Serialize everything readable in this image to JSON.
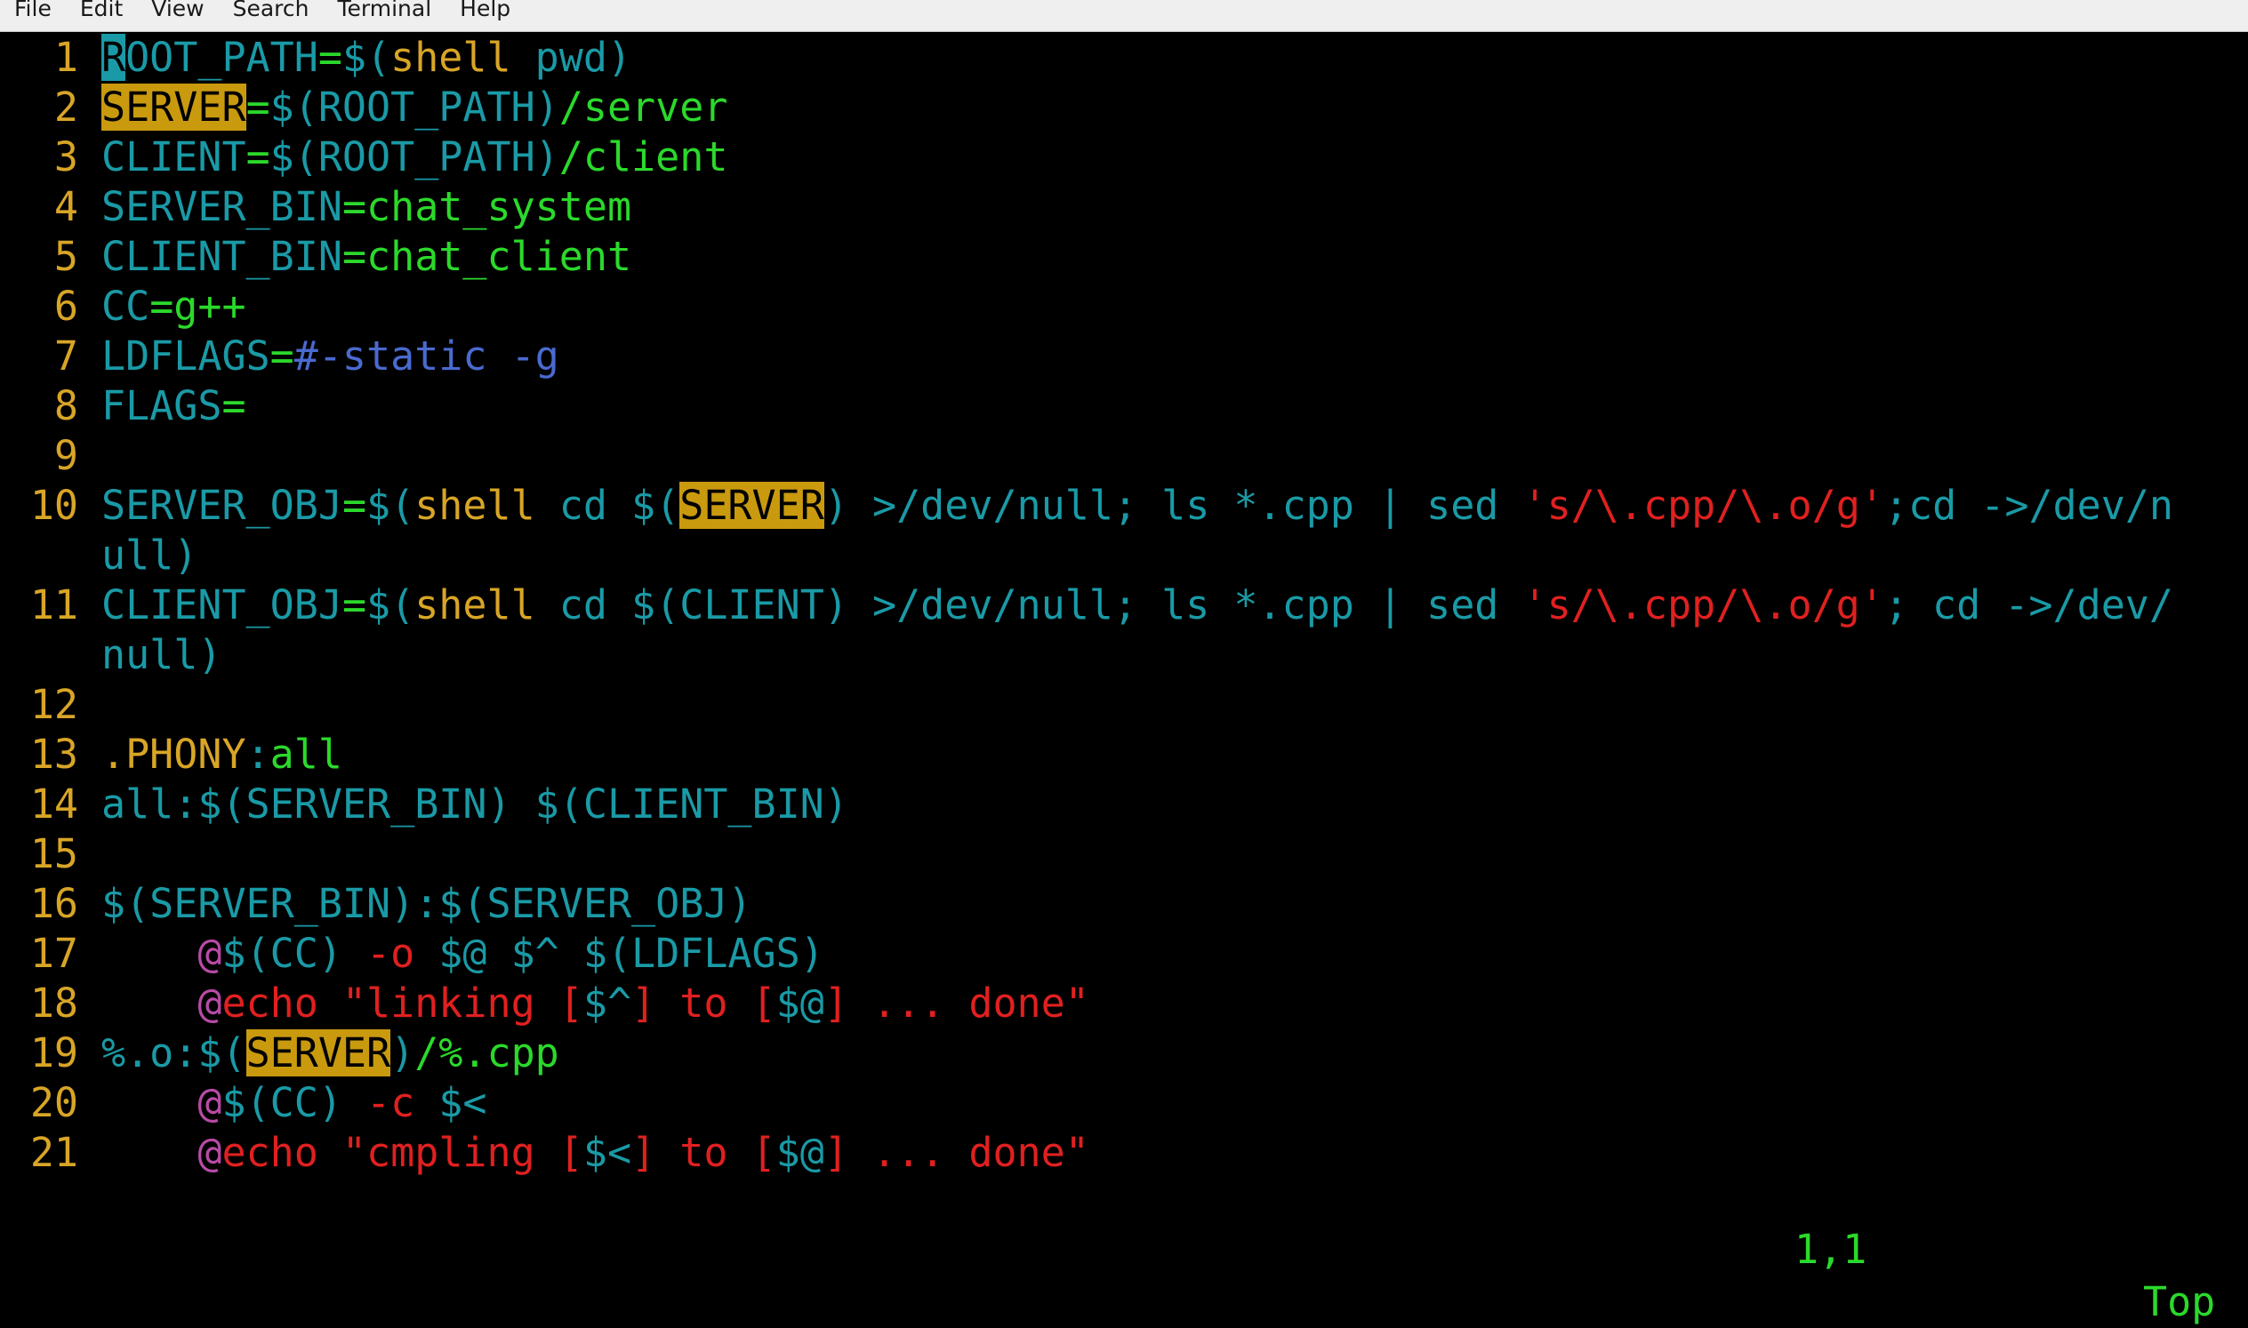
{
  "menubar": {
    "items": [
      "File",
      "Edit",
      "View",
      "Search",
      "Terminal",
      "Help"
    ]
  },
  "colors": {
    "background": "#000000",
    "line_number": "#d8a526",
    "identifier": "#1a9aa6",
    "value": "#2bd92b",
    "function": "#d8a526",
    "string": "#e02020",
    "comment": "#4a6ad0",
    "recipe_prefix": "#b84aa6",
    "search_highlight": "#c99a0e",
    "cursor": "#1a9aa6"
  },
  "editor": {
    "lines": [
      {
        "n": "1",
        "segs": [
          {
            "t": "R",
            "c": "cursor"
          },
          {
            "t": "OOT_PATH",
            "c": "identifier"
          },
          {
            "t": "=",
            "c": "value"
          },
          {
            "t": "$(",
            "c": "identifier"
          },
          {
            "t": "shell",
            "c": "function"
          },
          {
            "t": " pwd)",
            "c": "identifier"
          }
        ]
      },
      {
        "n": "2",
        "segs": [
          {
            "t": "SERVER",
            "c": "hl"
          },
          {
            "t": "=",
            "c": "value"
          },
          {
            "t": "$(ROOT_PATH)",
            "c": "identifier"
          },
          {
            "t": "/server",
            "c": "value"
          }
        ]
      },
      {
        "n": "3",
        "segs": [
          {
            "t": "CLIENT",
            "c": "identifier"
          },
          {
            "t": "=",
            "c": "value"
          },
          {
            "t": "$(ROOT_PATH)",
            "c": "identifier"
          },
          {
            "t": "/client",
            "c": "value"
          }
        ]
      },
      {
        "n": "4",
        "segs": [
          {
            "t": "SERVER_BIN",
            "c": "identifier"
          },
          {
            "t": "=chat_system",
            "c": "value"
          }
        ]
      },
      {
        "n": "5",
        "segs": [
          {
            "t": "CLIENT_BIN",
            "c": "identifier"
          },
          {
            "t": "=chat_client",
            "c": "value"
          }
        ]
      },
      {
        "n": "6",
        "segs": [
          {
            "t": "CC",
            "c": "identifier"
          },
          {
            "t": "=g++",
            "c": "value"
          }
        ]
      },
      {
        "n": "7",
        "segs": [
          {
            "t": "LDFLAGS",
            "c": "identifier"
          },
          {
            "t": "=",
            "c": "value"
          },
          {
            "t": "#-static -g",
            "c": "comment"
          }
        ]
      },
      {
        "n": "8",
        "segs": [
          {
            "t": "FLAGS",
            "c": "identifier"
          },
          {
            "t": "=",
            "c": "value"
          }
        ]
      },
      {
        "n": "9",
        "segs": []
      },
      {
        "n": "10",
        "segs": [
          {
            "t": "SERVER_OBJ",
            "c": "identifier"
          },
          {
            "t": "=",
            "c": "value"
          },
          {
            "t": "$(",
            "c": "identifier"
          },
          {
            "t": "shell",
            "c": "function"
          },
          {
            "t": " cd $(",
            "c": "identifier"
          },
          {
            "t": "SERVER",
            "c": "hl"
          },
          {
            "t": ") >/dev/null; ls *.cpp | sed ",
            "c": "identifier"
          },
          {
            "t": "'s/\\.cpp/\\.o/g'",
            "c": "string"
          },
          {
            "t": ";cd ->/dev/n",
            "c": "identifier"
          }
        ]
      },
      {
        "n": "",
        "segs": [
          {
            "t": "ull)",
            "c": "identifier"
          }
        ]
      },
      {
        "n": "11",
        "segs": [
          {
            "t": "CLIENT_OBJ",
            "c": "identifier"
          },
          {
            "t": "=",
            "c": "value"
          },
          {
            "t": "$(",
            "c": "identifier"
          },
          {
            "t": "shell",
            "c": "function"
          },
          {
            "t": " cd $(CLIENT) >/dev/null; ls *.cpp | sed ",
            "c": "identifier"
          },
          {
            "t": "'s/\\.cpp/\\.o/g'",
            "c": "string"
          },
          {
            "t": "; cd ->/dev/",
            "c": "identifier"
          }
        ]
      },
      {
        "n": "",
        "segs": [
          {
            "t": "null)",
            "c": "identifier"
          }
        ]
      },
      {
        "n": "12",
        "segs": []
      },
      {
        "n": "13",
        "segs": [
          {
            "t": ".PHONY",
            "c": "function"
          },
          {
            "t": ":",
            "c": "identifier"
          },
          {
            "t": "all",
            "c": "value"
          }
        ]
      },
      {
        "n": "14",
        "segs": [
          {
            "t": "all:$(SERVER_BIN) $(CLIENT_BIN)",
            "c": "identifier"
          }
        ]
      },
      {
        "n": "15",
        "segs": []
      },
      {
        "n": "16",
        "segs": [
          {
            "t": "$(SERVER_BIN):$(SERVER_OBJ)",
            "c": "identifier"
          }
        ]
      },
      {
        "n": "17",
        "segs": [
          {
            "t": "    ",
            "c": "identifier"
          },
          {
            "t": "@",
            "c": "recipe_prefix"
          },
          {
            "t": "$(CC) ",
            "c": "identifier"
          },
          {
            "t": "-o",
            "c": "string"
          },
          {
            "t": " $@ $^ $(LDFLAGS)",
            "c": "identifier"
          }
        ]
      },
      {
        "n": "18",
        "segs": [
          {
            "t": "    ",
            "c": "identifier"
          },
          {
            "t": "@",
            "c": "recipe_prefix"
          },
          {
            "t": "echo \"linking [",
            "c": "string"
          },
          {
            "t": "$^",
            "c": "identifier"
          },
          {
            "t": "] to [",
            "c": "string"
          },
          {
            "t": "$@",
            "c": "identifier"
          },
          {
            "t": "] ... done\"",
            "c": "string"
          }
        ]
      },
      {
        "n": "19",
        "segs": [
          {
            "t": "%.o:$(",
            "c": "identifier"
          },
          {
            "t": "SERVER",
            "c": "hl"
          },
          {
            "t": ")",
            "c": "identifier"
          },
          {
            "t": "/%.cpp",
            "c": "value"
          }
        ]
      },
      {
        "n": "20",
        "segs": [
          {
            "t": "    ",
            "c": "identifier"
          },
          {
            "t": "@",
            "c": "recipe_prefix"
          },
          {
            "t": "$(CC) ",
            "c": "identifier"
          },
          {
            "t": "-c",
            "c": "string"
          },
          {
            "t": " $<",
            "c": "identifier"
          }
        ]
      },
      {
        "n": "21",
        "segs": [
          {
            "t": "    ",
            "c": "identifier"
          },
          {
            "t": "@",
            "c": "recipe_prefix"
          },
          {
            "t": "echo \"cmpling [",
            "c": "string"
          },
          {
            "t": "$<",
            "c": "identifier"
          },
          {
            "t": "] to [",
            "c": "string"
          },
          {
            "t": "$@",
            "c": "identifier"
          },
          {
            "t": "] ... done\"",
            "c": "string"
          }
        ]
      }
    ]
  },
  "status": {
    "ruler": "1,1",
    "position": "Top"
  }
}
